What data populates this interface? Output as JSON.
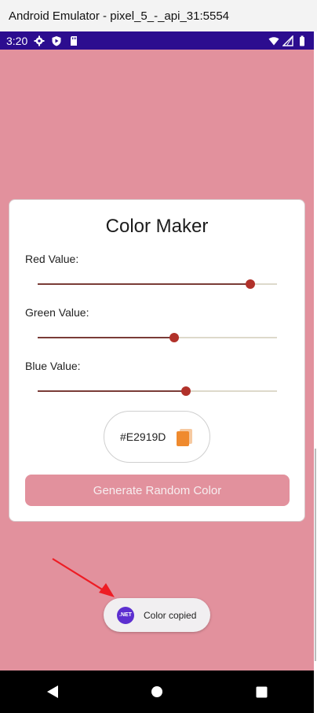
{
  "window": {
    "title": "Android Emulator - pixel_5_-_api_31:5554"
  },
  "statusbar": {
    "time": "3:20",
    "left_icons": [
      "gear-icon",
      "play-protect-icon",
      "sd-card-icon"
    ],
    "right_icons": [
      "wifi-icon",
      "signal-icon",
      "battery-icon"
    ]
  },
  "app": {
    "background_color": "#E2919D",
    "title": "Color Maker",
    "sliders": [
      {
        "label": "Red Value:",
        "value": 0.89
      },
      {
        "label": "Green Value:",
        "value": 0.57
      },
      {
        "label": "Blue Value:",
        "value": 0.62
      }
    ],
    "hex_value": "#E2919D",
    "copy_icon": "copy-icon",
    "generate_button_label": "Generate Random Color"
  },
  "toast": {
    "badge": ".NET",
    "message": "Color copied"
  },
  "navbar": {
    "buttons": [
      "back-icon",
      "home-icon",
      "recents-icon"
    ]
  }
}
